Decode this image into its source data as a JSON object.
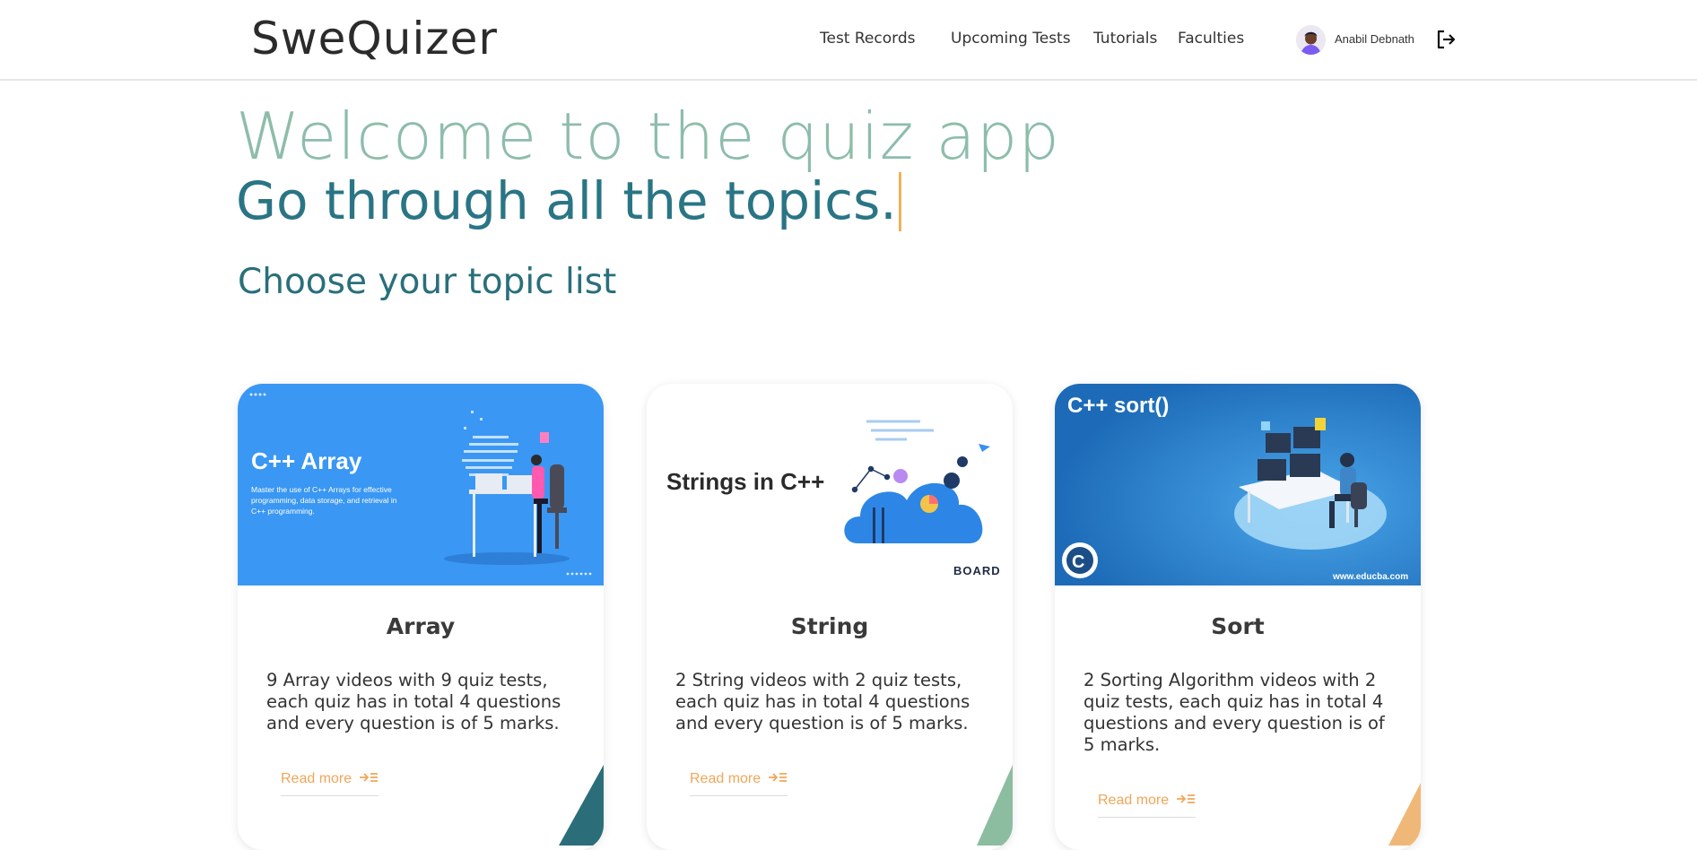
{
  "app": {
    "brand": "SweQuizer"
  },
  "nav": {
    "items": [
      {
        "label": "Test Records"
      },
      {
        "label": "Upcoming Tests"
      },
      {
        "label": "Tutorials"
      },
      {
        "label": "Faculties"
      }
    ],
    "user_name": "Anabil Debnath",
    "icons": {
      "avatar": "user-avatar",
      "logout": "logout-icon"
    }
  },
  "hero": {
    "line1": "Welcome to the quiz app",
    "line2": "Go through all the topics."
  },
  "section": {
    "title": "Choose your topic list"
  },
  "cards": [
    {
      "image_title": "C++ Array",
      "image_subtitle": "Master the use of C++ Arrays for effective programming, data storage, and retrieval in C++ programming.",
      "title": "Array",
      "description": "9 Array videos with 9 quiz tests, each quiz has in total 4 questions and every question is of 5 marks.",
      "read_more": "Read more",
      "accent": "#2b6e7a",
      "image_bg": "#3a97f3"
    },
    {
      "image_title": "Strings in C++",
      "image_badge": "BOARD",
      "title": "String",
      "description": "2 String videos with 2 quiz tests, each quiz has in total 4 questions and every question is of 5 marks.",
      "read_more": "Read more",
      "accent": "#8dbda0",
      "image_bg": "#ffffff"
    },
    {
      "image_title": "C++ sort()",
      "image_footer": "www.educba.com",
      "title": "Sort",
      "description": "2 Sorting Algorithm videos with 2 quiz tests, each quiz has in total 4 questions and every question is of 5 marks.",
      "read_more": "Read more",
      "accent": "#f0b878",
      "image_bg": "#2f86cf"
    }
  ],
  "colors": {
    "hero_line1": "#8dbdaa",
    "hero_line2": "#2a7585",
    "caret": "#f0b05a",
    "read_more": "#f0a65a"
  }
}
